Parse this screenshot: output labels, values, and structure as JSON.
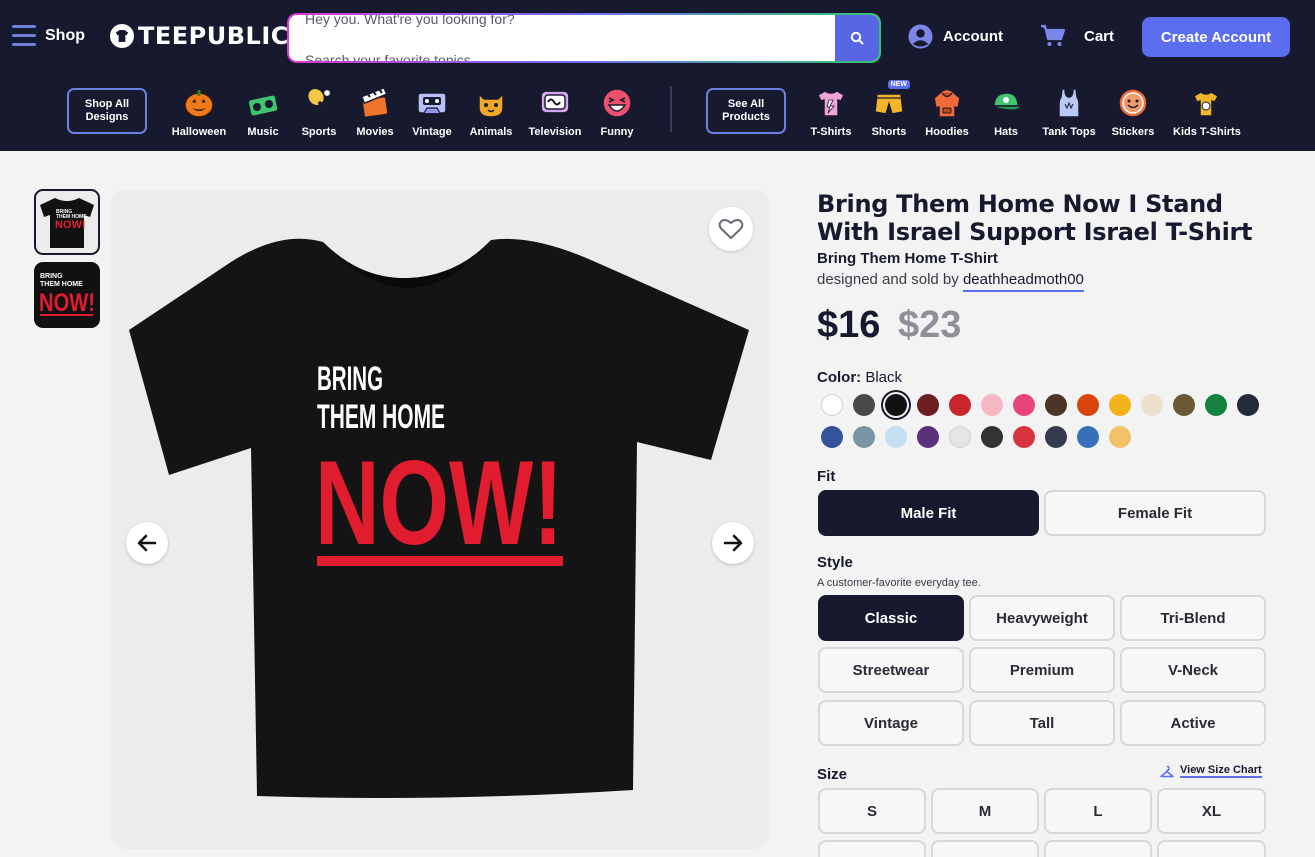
{
  "header": {
    "shop_label": "Shop",
    "logo_text": "TEEPUBLIC",
    "search_line1": "Hey you. What're you looking for?",
    "search_placeholder": "Search your favorite topics",
    "account_label": "Account",
    "cart_label": "Cart",
    "create_account_label": "Create Account",
    "brand_color": "#5c6ef0"
  },
  "category_bar": {
    "shop_all_label": "Shop All Designs",
    "see_all_label": "See All Products",
    "design_categories": [
      {
        "label": "Halloween",
        "icon": "pumpkin-icon"
      },
      {
        "label": "Music",
        "icon": "boombox-icon"
      },
      {
        "label": "Sports",
        "icon": "racket-ball-icon"
      },
      {
        "label": "Movies",
        "icon": "clapperboard-icon"
      },
      {
        "label": "Vintage",
        "icon": "cassette-icon"
      },
      {
        "label": "Animals",
        "icon": "cat-icon"
      },
      {
        "label": "Television",
        "icon": "tv-icon"
      },
      {
        "label": "Funny",
        "icon": "laughing-face-icon"
      }
    ],
    "product_categories": [
      {
        "label": "T-Shirts",
        "icon": "tshirt-icon"
      },
      {
        "label": "Shorts",
        "icon": "shorts-icon",
        "badge": "NEW"
      },
      {
        "label": "Hoodies",
        "icon": "hoodie-icon"
      },
      {
        "label": "Hats",
        "icon": "cap-icon"
      },
      {
        "label": "Tank Tops",
        "icon": "tank-top-icon"
      },
      {
        "label": "Stickers",
        "icon": "sticker-icon"
      },
      {
        "label": "Kids T-Shirts",
        "icon": "kids-tshirt-icon"
      }
    ]
  },
  "product": {
    "title": "Bring Them Home Now I Stand With Israel Support Israel T-Shirt",
    "subtitle": "Bring Them Home T-Shirt",
    "designed_by_prefix": "designed and sold by",
    "designer": "deathheadmoth00",
    "price": "$16",
    "old_price": "$23",
    "artwork": {
      "line1": "BRING",
      "line2": "THEM HOME",
      "line3": "NOW!"
    }
  },
  "color": {
    "label": "Color:",
    "selected": "Black",
    "swatches": [
      "#ffffff",
      "#4a4a4a",
      "#111111",
      "#6e1f24",
      "#c8262c",
      "#f6b8c4",
      "#e8457a",
      "#4a3528",
      "#d9440f",
      "#f2b31b",
      "#ece1cc",
      "#6a5a34",
      "#13823e",
      "#252a3a",
      "#33549a",
      "#7b95a2",
      "#c5def0",
      "#5c2f7a",
      "#e5e5e5",
      "#333333",
      "#d8343d",
      "#353a4c",
      "#3570b8",
      "#f2c26a"
    ],
    "selected_index": 2
  },
  "fit": {
    "label": "Fit",
    "options": [
      "Male Fit",
      "Female Fit"
    ],
    "selected_index": 0
  },
  "style": {
    "label": "Style",
    "description": "A customer-favorite everyday tee.",
    "options": [
      "Classic",
      "Heavyweight",
      "Tri-Blend",
      "Streetwear",
      "Premium",
      "V-Neck",
      "Vintage",
      "Tall",
      "Active"
    ],
    "selected_index": 0
  },
  "size": {
    "label": "Size",
    "size_chart_label": "View Size Chart",
    "options": [
      "S",
      "M",
      "L",
      "XL"
    ]
  }
}
